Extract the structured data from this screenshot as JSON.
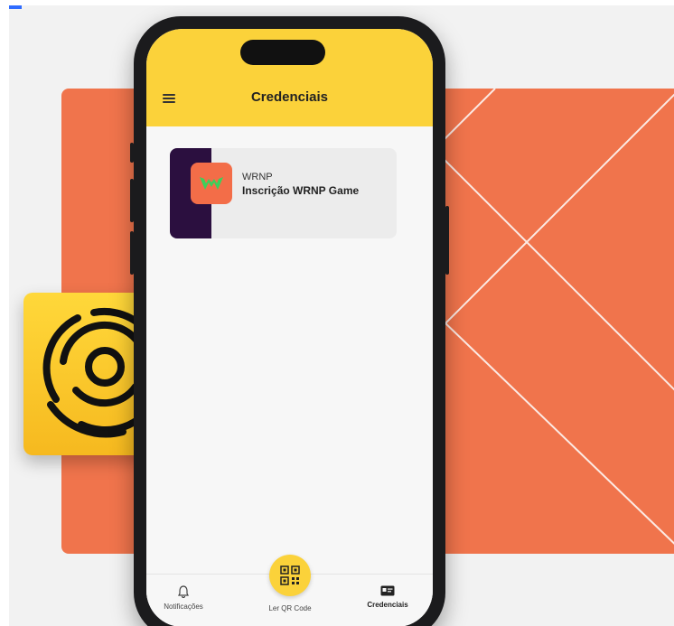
{
  "app": {
    "title": "Credenciais"
  },
  "credential": {
    "org": "WRNP",
    "name": "Inscrição WRNP Game"
  },
  "nav": {
    "notifications": "Notificações",
    "qr": "Ler QR Code",
    "credentials": "Credenciais"
  },
  "icons": {
    "menu": "menu-icon",
    "bell": "bell-icon",
    "qr": "qr-code-icon",
    "credentials": "id-card-icon",
    "app_logo": "concentric-circles-logo-icon",
    "org_logo": "wrnp-logo-icon"
  },
  "colors": {
    "accent": "#fbd23a",
    "orange": "#f0744c",
    "card_strip": "#2b0f3f"
  }
}
